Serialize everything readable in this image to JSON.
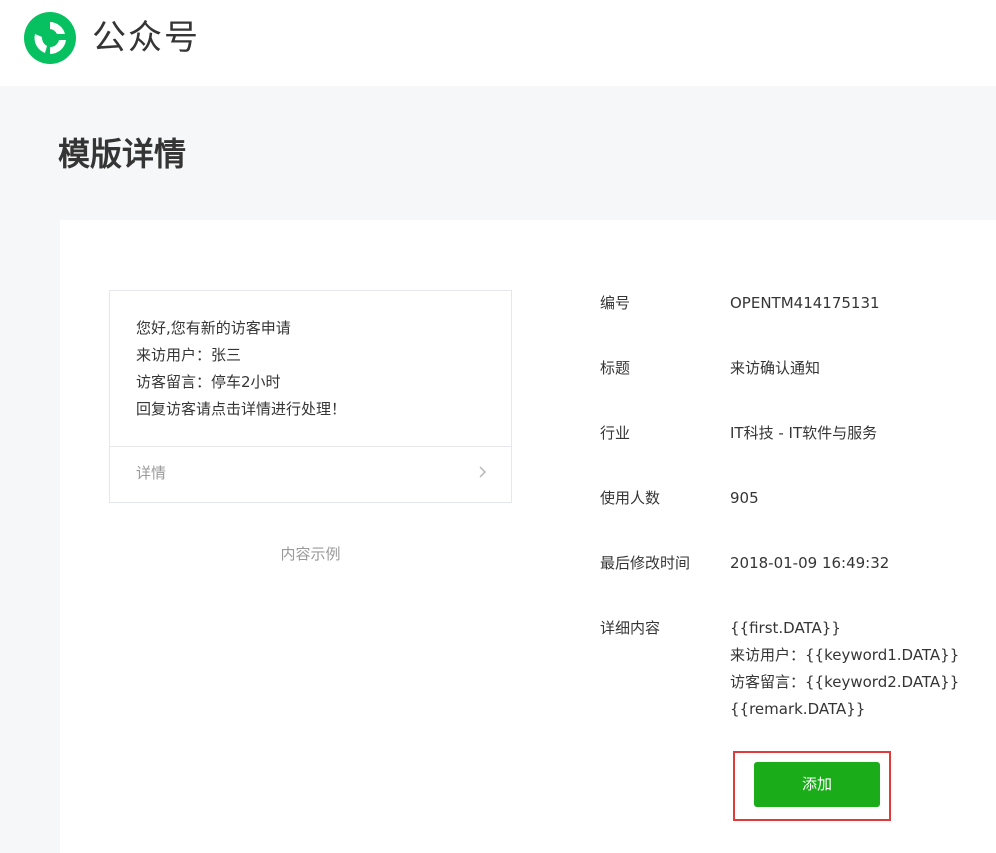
{
  "header": {
    "brand": "公众号",
    "logo_icon": "wechat-mp-logo-icon",
    "brand_color": "#07c160"
  },
  "page": {
    "title": "模版详情"
  },
  "preview": {
    "lines": [
      "您好,您有新的访客申请",
      "来访用户：张三",
      "访客留言：停车2小时",
      "回复访客请点击详情进行处理！"
    ],
    "detail_label": "详情",
    "caption": "内容示例"
  },
  "info": {
    "id_label": "编号",
    "id_value": "OPENTM414175131",
    "title_label": "标题",
    "title_value": "来访确认通知",
    "industry_label": "行业",
    "industry_value": "IT科技 - IT软件与服务",
    "users_label": "使用人数",
    "users_value": "905",
    "modified_label": "最后修改时间",
    "modified_value": "2018-01-09 16:49:32",
    "content_label": "详细内容",
    "content_lines": [
      "{{first.DATA}}",
      "来访用户：{{keyword1.DATA}}",
      "访客留言：{{keyword2.DATA}}",
      "{{remark.DATA}}"
    ]
  },
  "actions": {
    "add_label": "添加",
    "add_color": "#1aad19",
    "highlight_color": "#e03b3b"
  }
}
